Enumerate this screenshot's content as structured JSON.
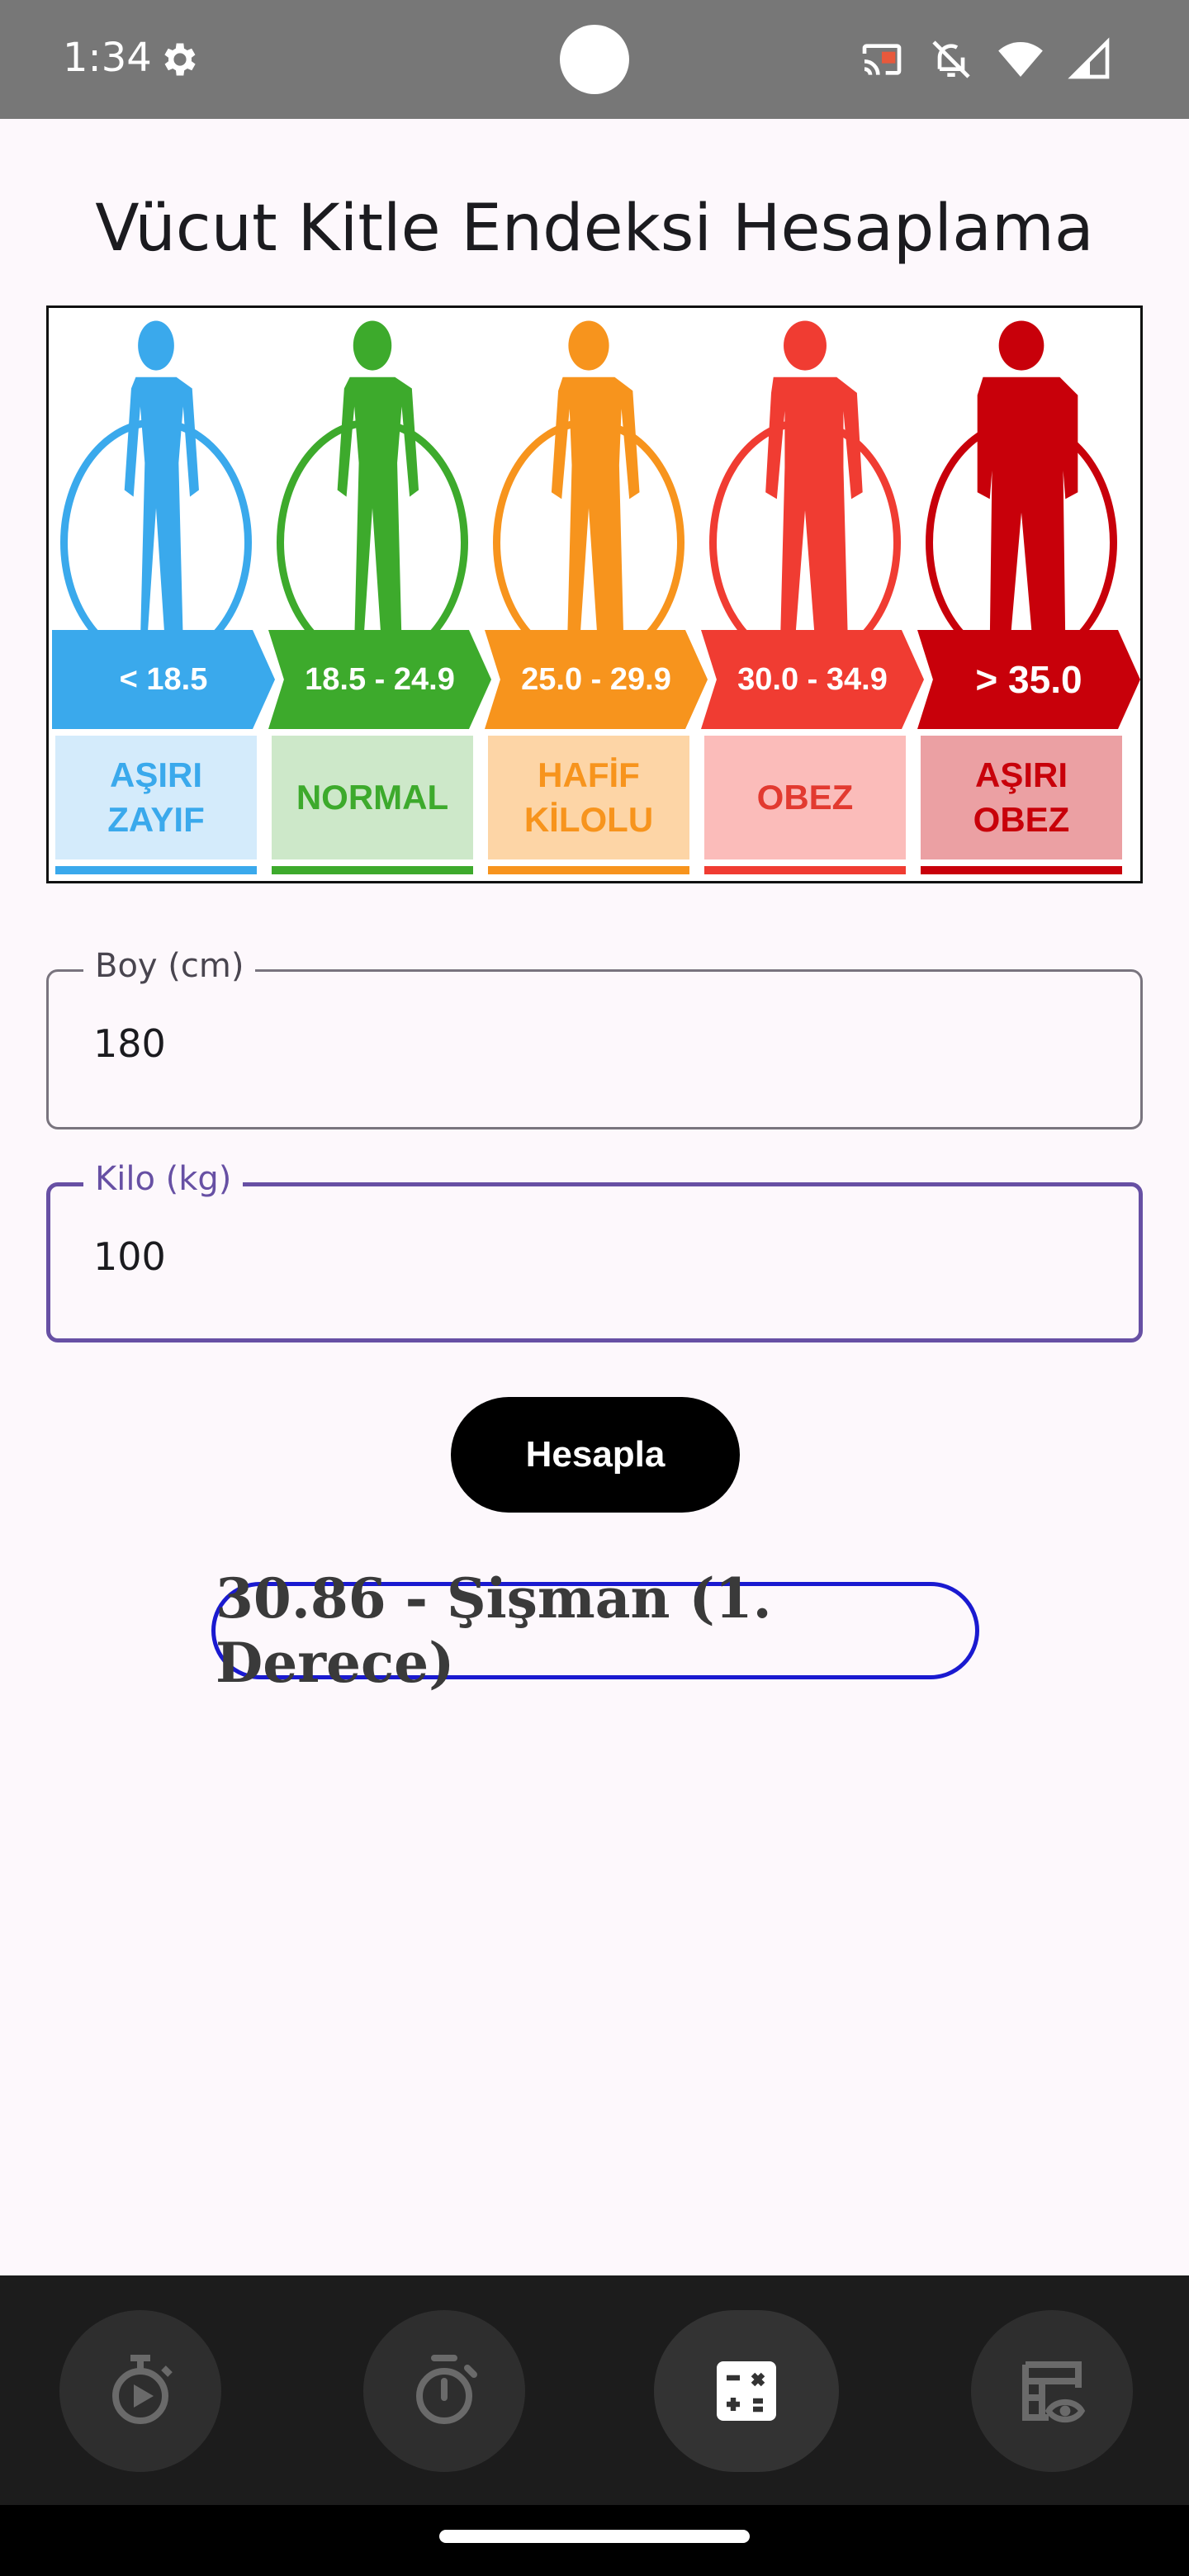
{
  "status_bar": {
    "time": "1:34",
    "icons": [
      "settings-icon",
      "cast-icon",
      "notifications-off-icon",
      "wifi-icon",
      "signal-icon"
    ]
  },
  "title": "Vücut Kitle Endeksi Hesaplama",
  "bmi_chart": {
    "categories": [
      {
        "range": "< 18.5",
        "label": "AŞIRI\nZAYIF",
        "color": "#3aa9ec",
        "label_bg": "#d4ebfb",
        "label_color": "#3aa9ec"
      },
      {
        "range": "18.5 - 24.9",
        "label": "NORMAL",
        "color": "#3daa2c",
        "label_bg": "#cde8c9",
        "label_color": "#3daa2c"
      },
      {
        "range": "25.0 - 29.9",
        "label": "HAFİF\nKİLOLU",
        "color": "#f7941d",
        "label_bg": "#fdd5a6",
        "label_color": "#f7941d"
      },
      {
        "range": "30.0 - 34.9",
        "label": "OBEZ",
        "color": "#f03c32",
        "label_bg": "#fbbcba",
        "label_color": "#e23a30"
      },
      {
        "range": "> 35.0",
        "label": "AŞIRI\nOBEZ",
        "color": "#c8000a",
        "label_bg": "#eba0a3",
        "label_color": "#c8000a"
      }
    ]
  },
  "form": {
    "height": {
      "label": "Boy (cm)",
      "value": "180"
    },
    "weight": {
      "label": "Kilo (kg)",
      "value": "100"
    }
  },
  "button_label": "Hesapla",
  "result": "30.86 - Şişman (1. Derece)",
  "bottom_nav": {
    "items": [
      {
        "icon": "stopwatch-play-icon"
      },
      {
        "icon": "timer-icon"
      },
      {
        "icon": "calculator-icon",
        "active": true
      },
      {
        "icon": "table-view-icon"
      }
    ]
  },
  "colors": {
    "accent": "#6750a4",
    "result_border": "#1a1ad0"
  }
}
